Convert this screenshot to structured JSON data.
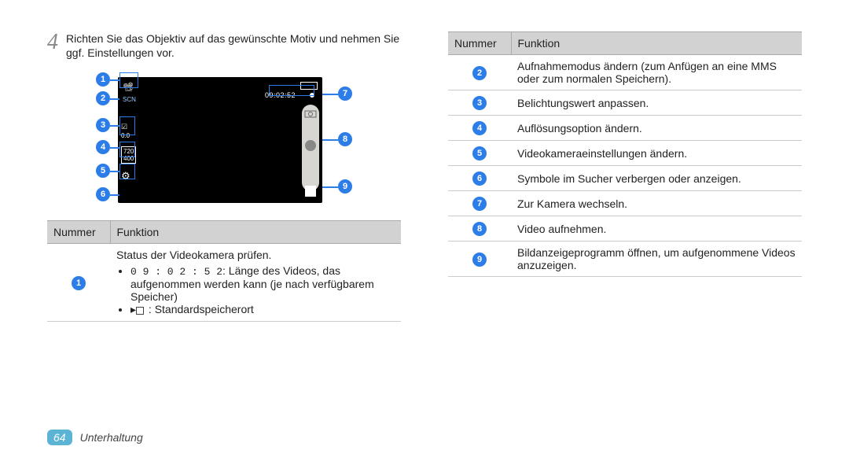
{
  "step": {
    "number": "4",
    "text": "Richten Sie das Objektiv auf das gewünschte Motiv und nehmen Sie ggf. Einstellungen vor."
  },
  "viewfinder": {
    "timer": "09:02:52"
  },
  "leftTable": {
    "headers": [
      "Nummer",
      "Funktion"
    ],
    "row1": {
      "status": "Status der Videokamera prüfen.",
      "bullet1_prefix": "0 9 : 0 2 : 5 2",
      "bullet1_rest": ": Länge des Videos, das aufgenommen werden kann (je nach verfügbarem Speicher)",
      "bullet2": ": Standardspeicherort"
    }
  },
  "rightTable": {
    "headers": [
      "Nummer",
      "Funktion"
    ],
    "rows": [
      "Aufnahmemodus ändern (zum Anfügen an eine MMS oder zum normalen Speichern).",
      "Belichtungswert anpassen.",
      "Auflösungsoption ändern.",
      "Videokameraeinstellungen ändern.",
      "Symbole im Sucher verbergen oder anzeigen.",
      "Zur Kamera wechseln.",
      "Video aufnehmen.",
      "Bildanzeigeprogramm öffnen, um aufgenommene Videos anzuzeigen."
    ]
  },
  "footer": {
    "pageNumber": "64",
    "section": "Unterhaltung"
  }
}
